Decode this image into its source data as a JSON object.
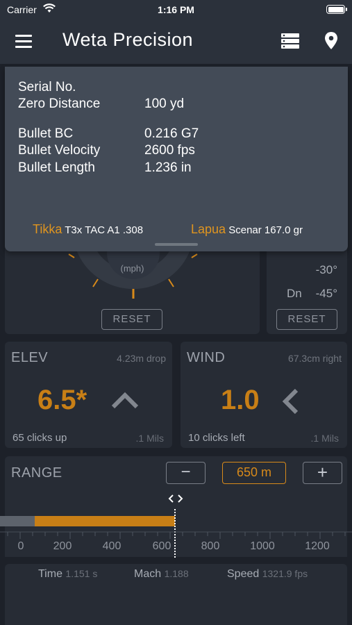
{
  "status": {
    "carrier": "Carrier",
    "time": "1:16 PM"
  },
  "nav": {
    "title": "Weta Precision",
    "icons": [
      "menu-icon",
      "list-icon",
      "location-pin-icon"
    ]
  },
  "profile": {
    "serial_label": "Serial No.",
    "zero_label": "Zero Distance",
    "zero_value": "100 yd",
    "bc_label": "Bullet BC",
    "bc_value": "0.216 G7",
    "velocity_label": "Bullet Velocity",
    "velocity_value": "2600 fps",
    "length_label": "Bullet Length",
    "length_value": "1.236 in",
    "rifle_brand": "Tikka",
    "rifle_model": "T3x TAC A1 .308",
    "ammo_brand": "Lapua",
    "ammo_model": "Scenar 167.0 gr"
  },
  "wind_dial": {
    "unit": "(mph)",
    "reset_label": "RESET"
  },
  "incline": {
    "up_value": "-30°",
    "down_label": "Dn",
    "down_value": "-45°",
    "reset_label": "RESET"
  },
  "elev": {
    "label": "ELEV",
    "drop": "4.23m drop",
    "value": "6.5*",
    "clicks": "65 clicks up",
    "unit": ".1 Mils"
  },
  "wind": {
    "label": "WIND",
    "drift": "67.3cm right",
    "value": "1.0",
    "clicks": "10 clicks left",
    "unit": ".1 Mils"
  },
  "range": {
    "label": "RANGE",
    "minus": "−",
    "plus": "+",
    "value": "650 m",
    "slider_current": 650,
    "slider_shaded_max": 90,
    "slider_max": 1300,
    "ticks": [
      "0",
      "200",
      "400",
      "600",
      "800",
      "1000",
      "1200"
    ]
  },
  "flight": {
    "time_label": "Time",
    "time_value": "1.151 s",
    "mach_label": "Mach",
    "mach_value": "1.188",
    "speed_label": "Speed",
    "speed_value": "1321.9 fps"
  },
  "colors": {
    "accent": "#d88a1a",
    "background": "#1d2129",
    "panel": "#272c35",
    "overlay": "#434b57"
  }
}
